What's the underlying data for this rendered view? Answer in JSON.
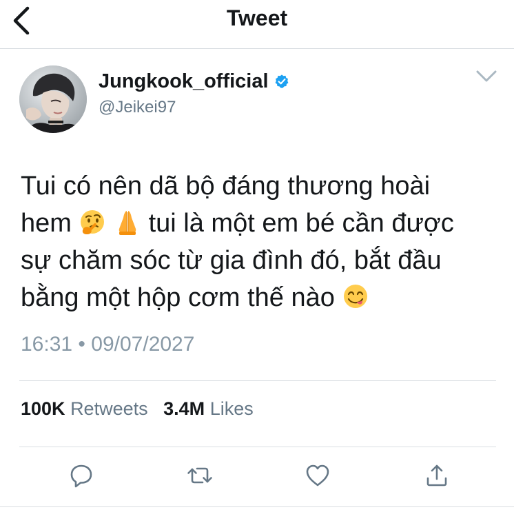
{
  "header": {
    "title": "Tweet",
    "back_icon": "chevron-left-icon"
  },
  "author": {
    "display_name": "Jungkook_official",
    "handle": "@Jeikei97",
    "verified": true,
    "verified_color": "#1da1f2",
    "avatar_icon": "profile-photo"
  },
  "tweet": {
    "lines": [
      "Tui có nên dã bộ đáng thương hoài",
      "hem",
      "tui là một em bé cần được",
      "sự chăm sóc từ gia đình đó, bắt đầu",
      "bằng một hộp cơm thế nào"
    ],
    "emojis": [
      "thinking-face-emoji",
      "folded-hands-emoji",
      "face-savoring-food-emoji"
    ],
    "time": "16:31",
    "separator": "•",
    "date": "09/07/2027"
  },
  "stats": {
    "retweets_count": "100K",
    "retweets_label": "Retweets",
    "likes_count": "3.4M",
    "likes_label": "Likes"
  },
  "actions": [
    "reply-icon",
    "retweet-icon",
    "like-icon",
    "share-icon"
  ],
  "colors": {
    "text": "#14171a",
    "secondary": "#657786",
    "timestamp": "#8899a6",
    "divider": "#d8dde1",
    "icon": "#657786"
  }
}
